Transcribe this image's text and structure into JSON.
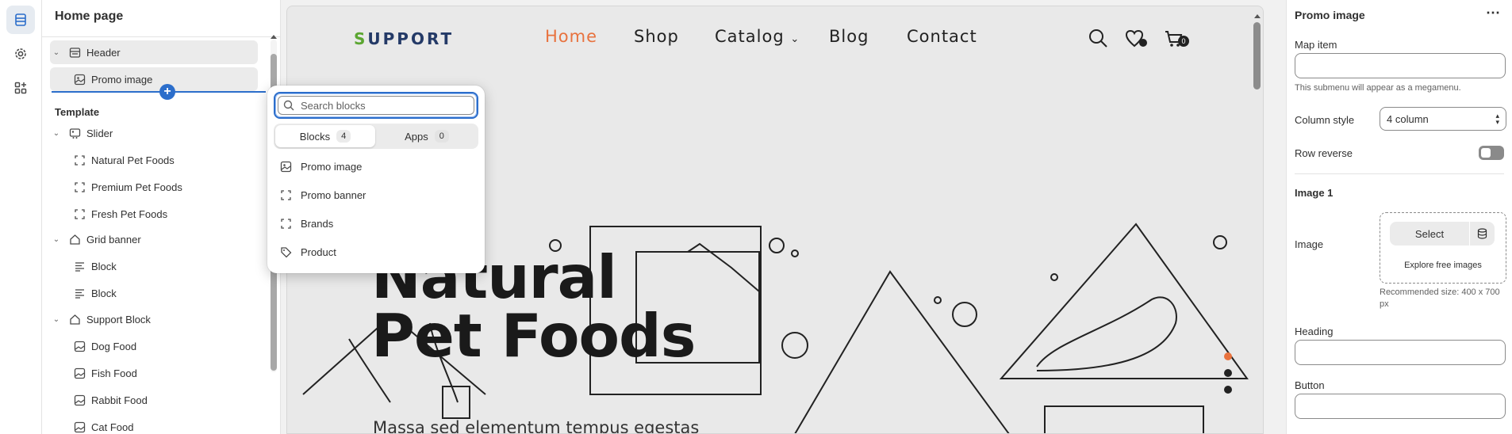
{
  "sidebar": {
    "title": "Home page",
    "header_group": {
      "label": "Header",
      "children": [
        {
          "label": "Promo image",
          "icon": "image-icon"
        }
      ]
    },
    "template_label": "Template",
    "groups": [
      {
        "label": "Slider",
        "icon": "slider-icon",
        "children": [
          "Natural Pet Foods",
          "Premium Pet Foods",
          "Fresh Pet Foods"
        ]
      },
      {
        "label": "Grid banner",
        "icon": "section-icon",
        "children": [
          "Block",
          "Block"
        ]
      },
      {
        "label": "Support Block",
        "icon": "section-icon",
        "children": [
          "Dog Food",
          "Fish Food",
          "Rabbit Food",
          "Cat Food"
        ]
      }
    ]
  },
  "popover": {
    "search_placeholder": "Search blocks",
    "tabs": [
      {
        "label": "Blocks",
        "count": "4"
      },
      {
        "label": "Apps",
        "count": "0"
      }
    ],
    "items": [
      {
        "label": "Promo image",
        "icon": "image-icon"
      },
      {
        "label": "Promo banner",
        "icon": "block-icon"
      },
      {
        "label": "Brands",
        "icon": "block-icon"
      },
      {
        "label": "Product",
        "icon": "tag-icon"
      }
    ]
  },
  "preview": {
    "logo": "UPPORT",
    "logo_first": "S",
    "nav": [
      "Home",
      "Shop",
      "Catalog",
      "Blog",
      "Contact"
    ],
    "cart_count": "0",
    "hero_line1": "Natural",
    "hero_line2": "Pet Foods",
    "hero_sub": "Massa sed elementum tempus egestas",
    "accent": "#e8723e"
  },
  "settings": {
    "title": "Promo image",
    "map_item_label": "Map item",
    "map_item_help": "This submenu will appear as a megamenu.",
    "column_style_label": "Column style",
    "column_style_value": "4 column",
    "row_reverse_label": "Row reverse",
    "image1_heading": "Image 1",
    "image_label": "Image",
    "select_label": "Select",
    "explore_label": "Explore free images",
    "recommended": "Recommended size: 400 x 700 px",
    "heading_label": "Heading",
    "button_label": "Button"
  }
}
